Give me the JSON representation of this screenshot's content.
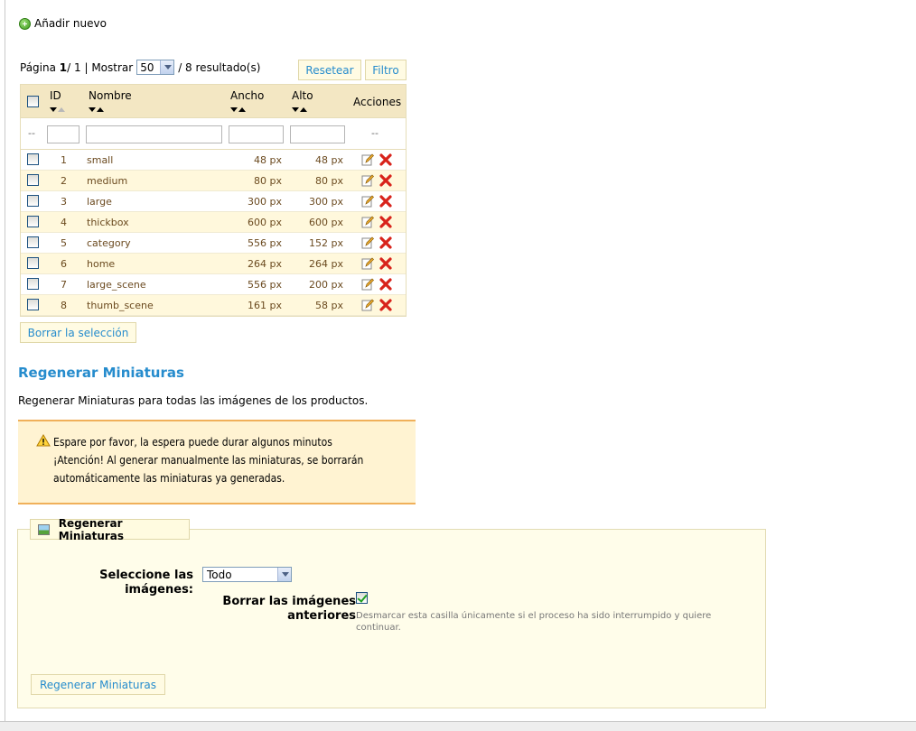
{
  "add_new_label": "Añadir nuevo",
  "pager": {
    "page_label": "Página",
    "page_current": "1",
    "page_sep": " / 1 | Mostrar",
    "per_page": "50",
    "results": "/ 8 resultado(s)",
    "reset_label": "Resetear",
    "filter_label": "Filtro"
  },
  "table": {
    "headers": {
      "id": "ID",
      "name": "Nombre",
      "width": "Ancho",
      "height": "Alto",
      "actions": "Acciones"
    },
    "filter_dash": "--",
    "rows": [
      {
        "id": "1",
        "name": "small",
        "width": "48 px",
        "height": "48 px"
      },
      {
        "id": "2",
        "name": "medium",
        "width": "80 px",
        "height": "80 px"
      },
      {
        "id": "3",
        "name": "large",
        "width": "300 px",
        "height": "300 px"
      },
      {
        "id": "4",
        "name": "thickbox",
        "width": "600 px",
        "height": "600 px"
      },
      {
        "id": "5",
        "name": "category",
        "width": "556 px",
        "height": "152 px"
      },
      {
        "id": "6",
        "name": "home",
        "width": "264 px",
        "height": "264 px"
      },
      {
        "id": "7",
        "name": "large_scene",
        "width": "556 px",
        "height": "200 px"
      },
      {
        "id": "8",
        "name": "thumb_scene",
        "width": "161 px",
        "height": "58 px"
      }
    ],
    "delete_selection_label": "Borrar la selección"
  },
  "regen": {
    "title": "Regenerar Miniaturas",
    "description": "Regenerar Miniaturas para todas las imágenes de los productos.",
    "warning_line1": "Espare por favor, la espera puede durar algunos minutos",
    "warning_line2": "¡Atención! Al generar manualmente las miniaturas, se borrarán automáticamente las miniaturas ya generadas.",
    "legend": "Regenerar Miniaturas",
    "select_label": "Seleccione las imágenes:",
    "select_value": "Todo",
    "erase_label": "Borrar las imágenes anteriores",
    "erase_hint": "Desmarcar esta casilla únicamente si el proceso ha sido interrumpido y quiere continuar.",
    "submit_label": "Regenerar Miniaturas"
  },
  "colors": {
    "accent": "#268ccd",
    "header_bg": "#f3e7c3",
    "row_alt": "#fff8dc",
    "warning_border": "#f0b05a"
  }
}
